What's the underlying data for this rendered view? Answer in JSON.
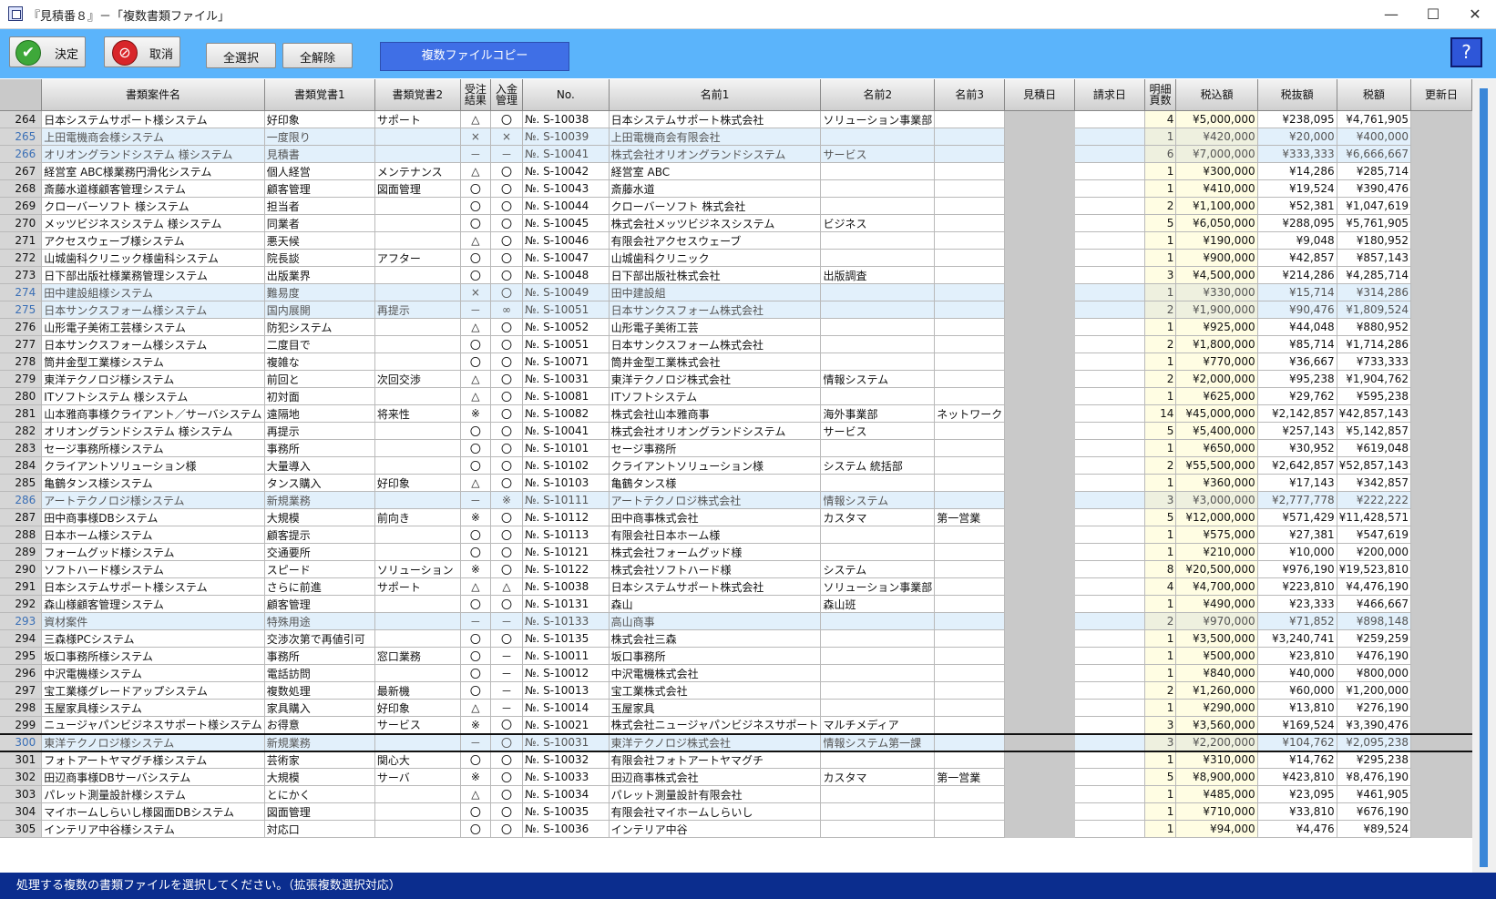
{
  "window": {
    "title": "『見積番８』－「複数書類ファイル」",
    "minimize": "—",
    "maximize": "☐",
    "close": "✕"
  },
  "toolbar": {
    "ok_label": "決定",
    "cancel_label": "取消",
    "select_all": "全選択",
    "deselect_all": "全解除",
    "copy_label": "複数ファイルコピー",
    "help_label": "?"
  },
  "columns": [
    "書類案件名",
    "書類覚書1",
    "書類覚書2",
    "受注\n結果",
    "入金\n管理",
    "No.",
    "名前1",
    "名前2",
    "名前3",
    "見積日",
    "請求日",
    "明細\n頁数",
    "税込額",
    "税抜額",
    "税額",
    "更新日"
  ],
  "rows": [
    {
      "n": "264",
      "name": "日本システムサポート様システム",
      "m1": "好印象",
      "m2": "サポート",
      "j": "△",
      "k": "〇",
      "no": "№. S-10038",
      "a": "日本システムサポート株式会社",
      "b": "ソリューション事業部",
      "c": "",
      "p": "4",
      "t": "¥5,000,000",
      "e": "¥238,095",
      "x": "¥4,761,905",
      "dim": false
    },
    {
      "n": "265",
      "name": "上田電機商会様システム",
      "m1": "一度限り",
      "m2": "",
      "j": "×",
      "k": "×",
      "no": "№. S-10039",
      "a": "上田電機商会有限会社",
      "b": "",
      "c": "",
      "p": "1",
      "t": "¥420,000",
      "e": "¥20,000",
      "x": "¥400,000",
      "dim": true
    },
    {
      "n": "266",
      "name": "オリオングランドシステム 様システム",
      "m1": "見積書",
      "m2": "",
      "j": "－",
      "k": "－",
      "no": "№. S-10041",
      "a": "株式会社オリオングランドシステム",
      "b": "サービス",
      "c": "",
      "p": "6",
      "t": "¥7,000,000",
      "e": "¥333,333",
      "x": "¥6,666,667",
      "dim": true
    },
    {
      "n": "267",
      "name": "経営室 ABC様業務円滑化システム",
      "m1": "個人経営",
      "m2": "メンテナンス",
      "j": "△",
      "k": "〇",
      "no": "№. S-10042",
      "a": "経営室 ABC",
      "b": "",
      "c": "",
      "p": "1",
      "t": "¥300,000",
      "e": "¥14,286",
      "x": "¥285,714",
      "dim": false
    },
    {
      "n": "268",
      "name": "斎藤水道様顧客管理システム",
      "m1": "顧客管理",
      "m2": "図面管理",
      "j": "〇",
      "k": "〇",
      "no": "№. S-10043",
      "a": "斎藤水道",
      "b": "",
      "c": "",
      "p": "1",
      "t": "¥410,000",
      "e": "¥19,524",
      "x": "¥390,476",
      "dim": false
    },
    {
      "n": "269",
      "name": "クローバーソフト 様システム",
      "m1": "担当者",
      "m2": "",
      "j": "〇",
      "k": "〇",
      "no": "№. S-10044",
      "a": "クローバーソフト 株式会社",
      "b": "",
      "c": "",
      "p": "2",
      "t": "¥1,100,000",
      "e": "¥52,381",
      "x": "¥1,047,619",
      "dim": false
    },
    {
      "n": "270",
      "name": "メッツビジネスシステム 様システム",
      "m1": "同業者",
      "m2": "",
      "j": "〇",
      "k": "〇",
      "no": "№. S-10045",
      "a": "株式会社メッツビジネスシステム",
      "b": "ビジネス",
      "c": "",
      "p": "5",
      "t": "¥6,050,000",
      "e": "¥288,095",
      "x": "¥5,761,905",
      "dim": false
    },
    {
      "n": "271",
      "name": "アクセスウェーブ様システム",
      "m1": "悪天候",
      "m2": "",
      "j": "△",
      "k": "〇",
      "no": "№. S-10046",
      "a": "有限会社アクセスウェーブ",
      "b": "",
      "c": "",
      "p": "1",
      "t": "¥190,000",
      "e": "¥9,048",
      "x": "¥180,952",
      "dim": false
    },
    {
      "n": "272",
      "name": "山城歯科クリニック様歯科システム",
      "m1": "院長談",
      "m2": "アフター",
      "j": "〇",
      "k": "〇",
      "no": "№. S-10047",
      "a": "山城歯科クリニック",
      "b": "",
      "c": "",
      "p": "1",
      "t": "¥900,000",
      "e": "¥42,857",
      "x": "¥857,143",
      "dim": false
    },
    {
      "n": "273",
      "name": "日下部出版社様業務管理システム",
      "m1": "出版業界",
      "m2": "",
      "j": "〇",
      "k": "〇",
      "no": "№. S-10048",
      "a": "日下部出版社株式会社",
      "b": "出版調査",
      "c": "",
      "p": "3",
      "t": "¥4,500,000",
      "e": "¥214,286",
      "x": "¥4,285,714",
      "dim": false
    },
    {
      "n": "274",
      "name": "田中建設組様システム",
      "m1": "難易度",
      "m2": "",
      "j": "×",
      "k": "〇",
      "no": "№. S-10049",
      "a": "田中建設組",
      "b": "",
      "c": "",
      "p": "1",
      "t": "¥330,000",
      "e": "¥15,714",
      "x": "¥314,286",
      "dim": true
    },
    {
      "n": "275",
      "name": "日本サンクスフォーム様システム",
      "m1": "国内展開",
      "m2": "再提示",
      "j": "－",
      "k": "∞",
      "no": "№. S-10051",
      "a": "日本サンクスフォーム株式会社",
      "b": "",
      "c": "",
      "p": "2",
      "t": "¥1,900,000",
      "e": "¥90,476",
      "x": "¥1,809,524",
      "dim": true
    },
    {
      "n": "276",
      "name": "山形電子美術工芸様システム",
      "m1": "防犯システム",
      "m2": "",
      "j": "△",
      "k": "〇",
      "no": "№. S-10052",
      "a": "山形電子美術工芸",
      "b": "",
      "c": "",
      "p": "1",
      "t": "¥925,000",
      "e": "¥44,048",
      "x": "¥880,952",
      "dim": false
    },
    {
      "n": "277",
      "name": "日本サンクスフォーム様システム",
      "m1": "二度目で",
      "m2": "",
      "j": "〇",
      "k": "〇",
      "no": "№. S-10051",
      "a": "日本サンクスフォーム株式会社",
      "b": "",
      "c": "",
      "p": "2",
      "t": "¥1,800,000",
      "e": "¥85,714",
      "x": "¥1,714,286",
      "dim": false
    },
    {
      "n": "278",
      "name": "筒井金型工業様システム",
      "m1": "複雑な",
      "m2": "",
      "j": "〇",
      "k": "〇",
      "no": "№. S-10071",
      "a": "筒井金型工業株式会社",
      "b": "",
      "c": "",
      "p": "1",
      "t": "¥770,000",
      "e": "¥36,667",
      "x": "¥733,333",
      "dim": false
    },
    {
      "n": "279",
      "name": "東洋テクノロジ様システム",
      "m1": "前回と",
      "m2": "次回交渉",
      "j": "△",
      "k": "〇",
      "no": "№. S-10031",
      "a": "東洋テクノロジ株式会社",
      "b": "情報システム",
      "c": "",
      "p": "2",
      "t": "¥2,000,000",
      "e": "¥95,238",
      "x": "¥1,904,762",
      "dim": false
    },
    {
      "n": "280",
      "name": "ITソフトシステム 様システム",
      "m1": "初対面",
      "m2": "",
      "j": "△",
      "k": "〇",
      "no": "№. S-10081",
      "a": "ITソフトシステム",
      "b": "",
      "c": "",
      "p": "1",
      "t": "¥625,000",
      "e": "¥29,762",
      "x": "¥595,238",
      "dim": false
    },
    {
      "n": "281",
      "name": "山本雅商事様クライアント／サーバシステム",
      "m1": "遠隔地",
      "m2": "将来性",
      "j": "※",
      "k": "〇",
      "no": "№. S-10082",
      "a": "株式会社山本雅商事",
      "b": "海外事業部",
      "c": "ネットワーク",
      "p": "14",
      "t": "¥45,000,000",
      "e": "¥2,142,857",
      "x": "¥42,857,143",
      "dim": false
    },
    {
      "n": "282",
      "name": "オリオングランドシステム 様システム",
      "m1": "再提示",
      "m2": "",
      "j": "〇",
      "k": "〇",
      "no": "№. S-10041",
      "a": "株式会社オリオングランドシステム",
      "b": "サービス",
      "c": "",
      "p": "5",
      "t": "¥5,400,000",
      "e": "¥257,143",
      "x": "¥5,142,857",
      "dim": false
    },
    {
      "n": "283",
      "name": "セージ事務所様システム",
      "m1": "事務所",
      "m2": "",
      "j": "〇",
      "k": "〇",
      "no": "№. S-10101",
      "a": "セージ事務所",
      "b": "",
      "c": "",
      "p": "1",
      "t": "¥650,000",
      "e": "¥30,952",
      "x": "¥619,048",
      "dim": false
    },
    {
      "n": "284",
      "name": "クライアントソリューション様",
      "m1": "大量導入",
      "m2": "",
      "j": "〇",
      "k": "〇",
      "no": "№. S-10102",
      "a": "クライアントソリューション様",
      "b": "システム 統括部",
      "c": "",
      "p": "2",
      "t": "¥55,500,000",
      "e": "¥2,642,857",
      "x": "¥52,857,143",
      "dim": false
    },
    {
      "n": "285",
      "name": "亀鶴タンス様システム",
      "m1": "タンス購入",
      "m2": "好印象",
      "j": "△",
      "k": "〇",
      "no": "№. S-10103",
      "a": "亀鶴タンス様",
      "b": "",
      "c": "",
      "p": "1",
      "t": "¥360,000",
      "e": "¥17,143",
      "x": "¥342,857",
      "dim": false
    },
    {
      "n": "286",
      "name": "アートテクノロジ様システム",
      "m1": "新規業務",
      "m2": "",
      "j": "－",
      "k": "※",
      "no": "№. S-10111",
      "a": "アートテクノロジ株式会社",
      "b": "情報システム",
      "c": "",
      "p": "3",
      "t": "¥3,000,000",
      "e": "¥2,777,778",
      "x": "¥222,222",
      "dim": true
    },
    {
      "n": "287",
      "name": "田中商事様DBシステム",
      "m1": "大規模",
      "m2": "前向き",
      "j": "※",
      "k": "〇",
      "no": "№. S-10112",
      "a": "田中商事株式会社",
      "b": "カスタマ",
      "c": "第一営業",
      "p": "5",
      "t": "¥12,000,000",
      "e": "¥571,429",
      "x": "¥11,428,571",
      "dim": false
    },
    {
      "n": "288",
      "name": "日本ホーム様システム",
      "m1": "顧客提示",
      "m2": "",
      "j": "〇",
      "k": "〇",
      "no": "№. S-10113",
      "a": "有限会社日本ホーム様",
      "b": "",
      "c": "",
      "p": "1",
      "t": "¥575,000",
      "e": "¥27,381",
      "x": "¥547,619",
      "dim": false
    },
    {
      "n": "289",
      "name": "フォームグッド様システム",
      "m1": "交通要所",
      "m2": "",
      "j": "〇",
      "k": "〇",
      "no": "№. S-10121",
      "a": "株式会社フォームグッド様",
      "b": "",
      "c": "",
      "p": "1",
      "t": "¥210,000",
      "e": "¥10,000",
      "x": "¥200,000",
      "dim": false
    },
    {
      "n": "290",
      "name": "ソフトハード様システム",
      "m1": "スピード",
      "m2": "ソリューション",
      "j": "※",
      "k": "〇",
      "no": "№. S-10122",
      "a": "株式会社ソフトハード様",
      "b": "システム",
      "c": "",
      "p": "8",
      "t": "¥20,500,000",
      "e": "¥976,190",
      "x": "¥19,523,810",
      "dim": false
    },
    {
      "n": "291",
      "name": "日本システムサポート様システム",
      "m1": "さらに前進",
      "m2": "サポート",
      "j": "△",
      "k": "△",
      "no": "№. S-10038",
      "a": "日本システムサポート株式会社",
      "b": "ソリューション事業部",
      "c": "",
      "p": "4",
      "t": "¥4,700,000",
      "e": "¥223,810",
      "x": "¥4,476,190",
      "dim": false
    },
    {
      "n": "292",
      "name": "森山様顧客管理システム",
      "m1": "顧客管理",
      "m2": "",
      "j": "〇",
      "k": "〇",
      "no": "№. S-10131",
      "a": "森山",
      "b": "森山班",
      "c": "",
      "p": "1",
      "t": "¥490,000",
      "e": "¥23,333",
      "x": "¥466,667",
      "dim": false
    },
    {
      "n": "293",
      "name": "資材案件",
      "m1": "特殊用途",
      "m2": "",
      "j": "－",
      "k": "－",
      "no": "№. S-10133",
      "a": "高山商事",
      "b": "",
      "c": "",
      "p": "2",
      "t": "¥970,000",
      "e": "¥71,852",
      "x": "¥898,148",
      "dim": true
    },
    {
      "n": "294",
      "name": "三森様PCシステム",
      "m1": "交渉次第で再値引可",
      "m2": "",
      "j": "〇",
      "k": "〇",
      "no": "№. S-10135",
      "a": "株式会社三森",
      "b": "",
      "c": "",
      "p": "1",
      "t": "¥3,500,000",
      "e": "¥3,240,741",
      "x": "¥259,259",
      "dim": false
    },
    {
      "n": "295",
      "name": "坂口事務所様システム",
      "m1": "事務所",
      "m2": "窓口業務",
      "j": "〇",
      "k": "－",
      "no": "№. S-10011",
      "a": "坂口事務所",
      "b": "",
      "c": "",
      "p": "1",
      "t": "¥500,000",
      "e": "¥23,810",
      "x": "¥476,190",
      "dim": false
    },
    {
      "n": "296",
      "name": "中沢電機様システム",
      "m1": "電話訪問",
      "m2": "",
      "j": "〇",
      "k": "－",
      "no": "№. S-10012",
      "a": "中沢電機株式会社",
      "b": "",
      "c": "",
      "p": "1",
      "t": "¥840,000",
      "e": "¥40,000",
      "x": "¥800,000",
      "dim": false
    },
    {
      "n": "297",
      "name": "宝工業様グレードアップシステム",
      "m1": "複数処理",
      "m2": "最新機",
      "j": "〇",
      "k": "－",
      "no": "№. S-10013",
      "a": "宝工業株式会社",
      "b": "",
      "c": "",
      "p": "2",
      "t": "¥1,260,000",
      "e": "¥60,000",
      "x": "¥1,200,000",
      "dim": false
    },
    {
      "n": "298",
      "name": "玉屋家具様システム",
      "m1": "家具購入",
      "m2": "好印象",
      "j": "△",
      "k": "－",
      "no": "№. S-10014",
      "a": "玉屋家具",
      "b": "",
      "c": "",
      "p": "1",
      "t": "¥290,000",
      "e": "¥13,810",
      "x": "¥276,190",
      "dim": false
    },
    {
      "n": "299",
      "name": "ニュージャパンビジネスサポート様システム",
      "m1": "お得意",
      "m2": "サービス",
      "j": "※",
      "k": "〇",
      "no": "№. S-10021",
      "a": "株式会社ニュージャパンビジネスサポート",
      "b": "マルチメディア",
      "c": "",
      "p": "3",
      "t": "¥3,560,000",
      "e": "¥169,524",
      "x": "¥3,390,476",
      "dim": false
    },
    {
      "n": "300",
      "name": "東洋テクノロジ様システム",
      "m1": "新規業務",
      "m2": "",
      "j": "－",
      "k": "〇",
      "no": "№. S-10031",
      "a": "東洋テクノロジ株式会社",
      "b": "情報システム第一課",
      "c": "",
      "p": "3",
      "t": "¥2,200,000",
      "e": "¥104,762",
      "x": "¥2,095,238",
      "dim": true
    },
    {
      "n": "301",
      "name": "フォトアートヤマグチ様システム",
      "m1": "芸術家",
      "m2": "関心大",
      "j": "〇",
      "k": "〇",
      "no": "№. S-10032",
      "a": "有限会社フォトアートヤマグチ",
      "b": "",
      "c": "",
      "p": "1",
      "t": "¥310,000",
      "e": "¥14,762",
      "x": "¥295,238",
      "dim": false
    },
    {
      "n": "302",
      "name": "田辺商事様DBサーバシステム",
      "m1": "大規模",
      "m2": "サーバ",
      "j": "※",
      "k": "〇",
      "no": "№. S-10033",
      "a": "田辺商事株式会社",
      "b": "カスタマ",
      "c": "第一営業",
      "p": "5",
      "t": "¥8,900,000",
      "e": "¥423,810",
      "x": "¥8,476,190",
      "dim": false
    },
    {
      "n": "303",
      "name": "パレット測量設計様システム",
      "m1": "とにかく",
      "m2": "",
      "j": "△",
      "k": "〇",
      "no": "№. S-10034",
      "a": "パレット測量設計有限会社",
      "b": "",
      "c": "",
      "p": "1",
      "t": "¥485,000",
      "e": "¥23,095",
      "x": "¥461,905",
      "dim": false
    },
    {
      "n": "304",
      "name": "マイホームしらいし様図面DBシステム",
      "m1": "図面管理",
      "m2": "",
      "j": "〇",
      "k": "〇",
      "no": "№. S-10035",
      "a": "有限会社マイホームしらいし",
      "b": "",
      "c": "",
      "p": "1",
      "t": "¥710,000",
      "e": "¥33,810",
      "x": "¥676,190",
      "dim": false
    },
    {
      "n": "305",
      "name": "インテリア中谷様システム",
      "m1": "対応口",
      "m2": "",
      "j": "〇",
      "k": "〇",
      "no": "№. S-10036",
      "a": "インテリア中谷",
      "b": "",
      "c": "",
      "p": "1",
      "t": "¥94,000",
      "e": "¥4,476",
      "x": "¥89,524",
      "dim": false
    }
  ],
  "selected_row": "300",
  "status": {
    "message": "処理する複数の書類ファイルを選択してください。（拡張複数選択対応）"
  },
  "colors": {
    "toolbar": "#5bb4fb",
    "status": "#0b2d8e",
    "copy_button": "#3f6fe6",
    "dim_row": "#e2f0fb"
  }
}
